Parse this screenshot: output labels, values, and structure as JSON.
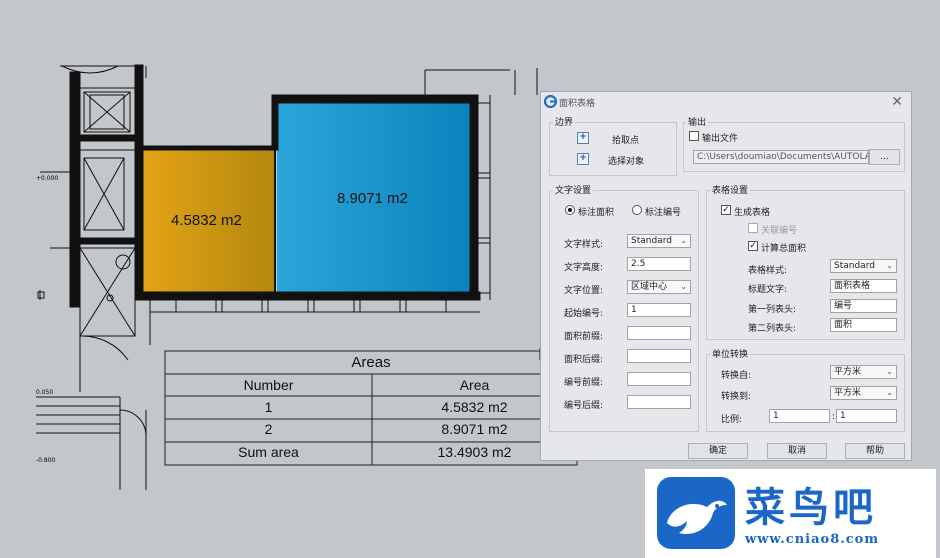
{
  "drawing": {
    "rooms": [
      {
        "label": "4.5832 m2",
        "color_from": "#e0a014",
        "color_to": "#b8870e"
      },
      {
        "label": "8.9071 m2",
        "color_from": "#26a3d8",
        "color_to": "#0c86bf"
      }
    ],
    "elevations": [
      "+0.000",
      "0.050",
      "-0.800"
    ],
    "table": {
      "title": "Areas",
      "headers": [
        "Number",
        "Area"
      ],
      "rows": [
        [
          "1",
          "4.5832 m2"
        ],
        [
          "2",
          "8.9071 m2"
        ],
        [
          "Sum area",
          "13.4903 m2"
        ]
      ]
    }
  },
  "dialog": {
    "title": "面积表格",
    "boundary": {
      "label": "边界",
      "pick_point": "拾取点",
      "select_object": "选择对象"
    },
    "output": {
      "label": "输出",
      "output_file": "输出文件",
      "output_file_checked": false,
      "path": "C:\\Users\\doumiao\\Documents\\AUTOLAYOU",
      "browse": "..."
    },
    "text_settings": {
      "label": "文字设置",
      "radio_area": "标注面积",
      "radio_number": "标注编号",
      "selected": "标注面积",
      "fields": [
        {
          "label": "文字样式:",
          "value": "Standard",
          "kind": "combo"
        },
        {
          "label": "文字高度:",
          "value": "2.5",
          "kind": "input"
        },
        {
          "label": "文字位置:",
          "value": "区域中心",
          "kind": "combo"
        },
        {
          "label": "起始编号:",
          "value": "1",
          "kind": "input"
        },
        {
          "label": "面积前缀:",
          "value": "",
          "kind": "input"
        },
        {
          "label": "面积后缀:",
          "value": "",
          "kind": "input"
        },
        {
          "label": "编号前缀:",
          "value": "",
          "kind": "input"
        },
        {
          "label": "编号后缀:",
          "value": "",
          "kind": "input"
        }
      ]
    },
    "table_settings": {
      "label": "表格设置",
      "generate_table": "生成表格",
      "generate_table_checked": true,
      "link_number": "关联编号",
      "link_number_checked": false,
      "calc_total": "计算总面积",
      "calc_total_checked": true,
      "fields": [
        {
          "label": "表格样式:",
          "value": "Standard",
          "kind": "combo"
        },
        {
          "label": "标题文字:",
          "value": "面积表格",
          "kind": "input"
        },
        {
          "label": "第一列表头:",
          "value": "编号",
          "kind": "input"
        },
        {
          "label": "第二列表头:",
          "value": "面积",
          "kind": "input"
        }
      ]
    },
    "unit_convert": {
      "label": "单位转换",
      "from_label": "转换自:",
      "from_value": "平方米",
      "to_label": "转换到:",
      "to_value": "平方米",
      "ratio_label": "比例:",
      "ratio_left": "1",
      "ratio_sep": ":",
      "ratio_right": "1"
    },
    "buttons": {
      "ok": "确定",
      "cancel": "取消",
      "help": "帮助"
    }
  },
  "watermark": {
    "name": "菜鸟吧",
    "url": "www.cniao8.com",
    "color": "#1a67c8"
  }
}
